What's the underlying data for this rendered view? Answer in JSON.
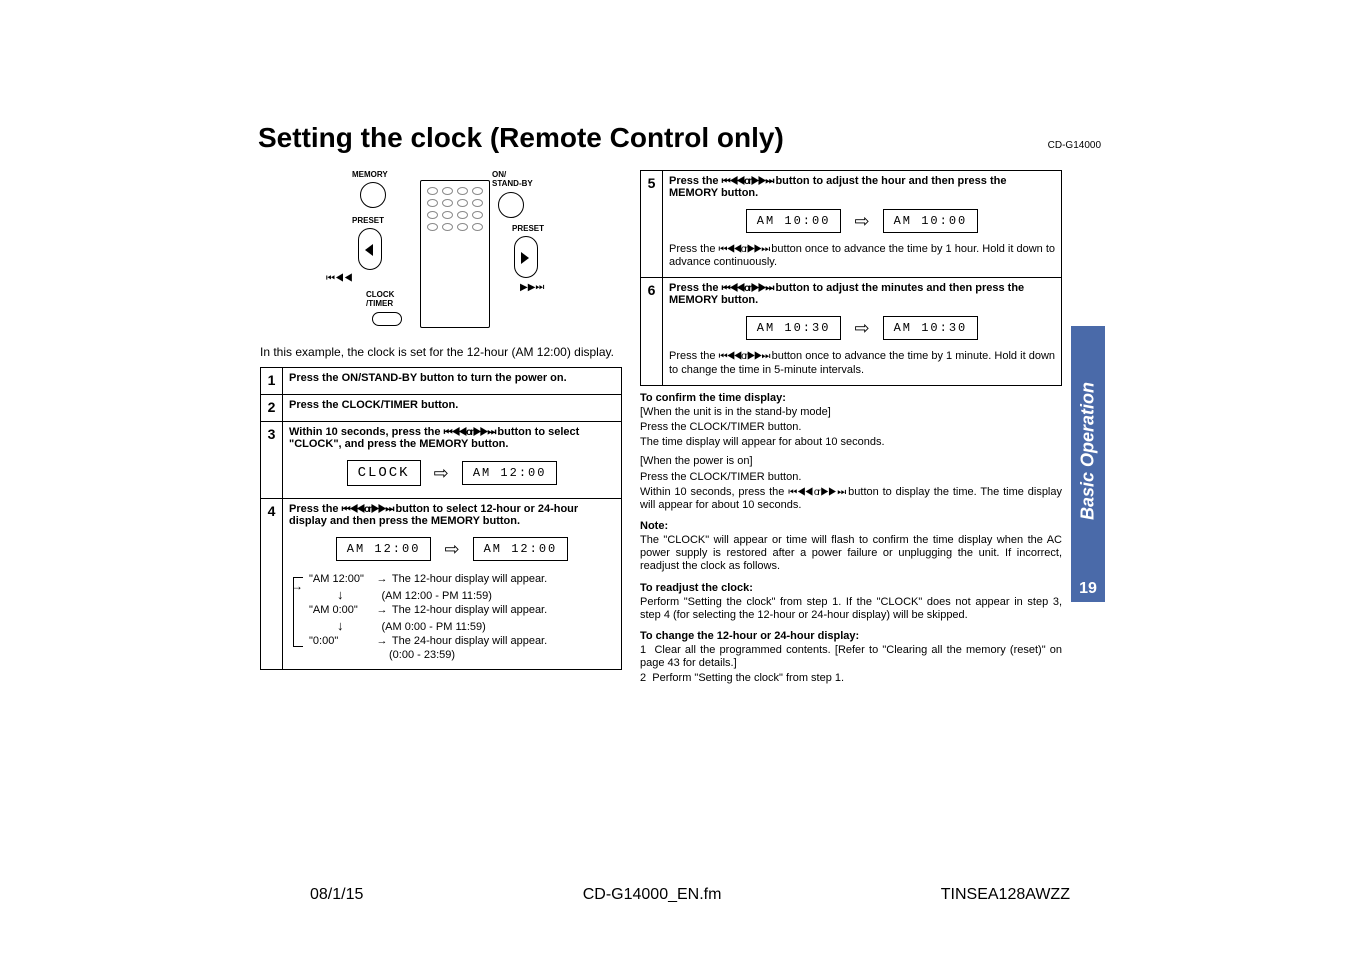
{
  "model_code": "CD-G14000",
  "title": "Setting the clock (Remote Control only)",
  "remote_labels": {
    "memory": "MEMORY",
    "on_standby": "ON/\nSTAND-BY",
    "preset_l": "PRESET",
    "preset_r": "PRESET",
    "clock_timer": "CLOCK\n/TIMER",
    "skip_back": "⏮◀◀",
    "skip_fwd": "▶▶⏭"
  },
  "example_line": "In this example, the clock is set for the 12-hour (AM 12:00) display.",
  "steps": {
    "1": "Press the ON/STAND-BY button to turn the power on.",
    "2": "Press the CLOCK/TIMER button.",
    "3": {
      "text_before": "Within 10 seconds, press the ",
      "glyph": "⏮ ◀◀ or ▶▶ ⏭",
      "text_after": " button to select \"CLOCK\", and press the MEMORY button.",
      "lcd": "CLOCK",
      "lcd_right": "AM   12:00"
    },
    "4": {
      "text_before": "Press the ",
      "glyph": "⏮ ◀◀ or ▶▶ ⏭",
      "text_after": " button to select 12-hour or 24-hour display and then press the MEMORY button.",
      "lcd_left": "AM   12:00",
      "lcd_right": "AM   12:00",
      "rows": [
        {
          "t": "\"AM 12:00\"",
          "d": "The 12-hour display will appear.",
          "sub": "(AM 12:00 - PM 11:59)"
        },
        {
          "t": "\"AM 0:00\"",
          "d": "The 12-hour display will appear.",
          "sub": "(AM 0:00 - PM 11:59)"
        },
        {
          "t": "\"0:00\"",
          "d": "The 24-hour display will appear.",
          "sub": "(0:00 - 23:59)"
        }
      ]
    },
    "5": {
      "text_before": "Press the ",
      "glyph": "⏮ ◀◀ or ▶▶ ⏭",
      "text_after": " button to adjust the hour and then press the MEMORY button.",
      "lcd_left": "AM   10:00",
      "lcd_right": "AM   10:00",
      "note_before": "Press the ",
      "note_glyph": "⏮ ◀◀ or ▶▶ ⏭",
      "note_after": " button once to advance the time by 1 hour. Hold it down to advance continuously."
    },
    "6": {
      "text_before": "Press the ",
      "glyph": "⏮ ◀◀ or ▶▶ ⏭",
      "text_after": " button to adjust the minutes and then press the MEMORY button.",
      "lcd_left": "AM   10:30",
      "lcd_right": "AM   10:30",
      "note_before": "Press the ",
      "note_glyph": "⏮ ◀◀ or ▶▶ ⏭",
      "note_after": " button once to advance the time by 1 minute. Hold it down to change the time in 5-minute intervals."
    }
  },
  "confirm": {
    "head": "To confirm the time display:",
    "sb1": "[When the unit is in the stand-by mode]",
    "sb2": "Press the CLOCK/TIMER button.",
    "sb3": "The time display will appear for about 10 seconds.",
    "on1": "[When the power is on]",
    "on2": "Press the CLOCK/TIMER button.",
    "on3_before": "Within 10 seconds, press the ",
    "on3_glyph": "⏮ ◀◀ or ▶▶ ⏭",
    "on3_after": " button to display the time. The time display will appear for about 10 seconds."
  },
  "note": {
    "head": "Note:",
    "body": "The \"CLOCK\" will appear or time will flash to confirm the time display when the AC power supply is restored after a power failure or unplugging the unit. If incorrect, readjust the clock as follows."
  },
  "readjust": {
    "head": "To readjust the clock:",
    "body": "Perform \"Setting the clock\" from step 1. If the \"CLOCK\" does not appear in step 3, step 4 (for selecting the 12-hour or 24-hour display) will be skipped."
  },
  "change": {
    "head": "To change the 12-hour or 24-hour display:",
    "li1": "Clear all the programmed contents. [Refer to \"Clearing all the memory (reset)\" on page 43 for details.]",
    "li2": "Perform \"Setting the clock\" from step 1."
  },
  "side_tab": "Basic Operation",
  "page_num": "19",
  "footer": {
    "date": "08/1/15",
    "file": "CD-G14000_EN.fm",
    "code": "TINSEA128AWZZ"
  }
}
